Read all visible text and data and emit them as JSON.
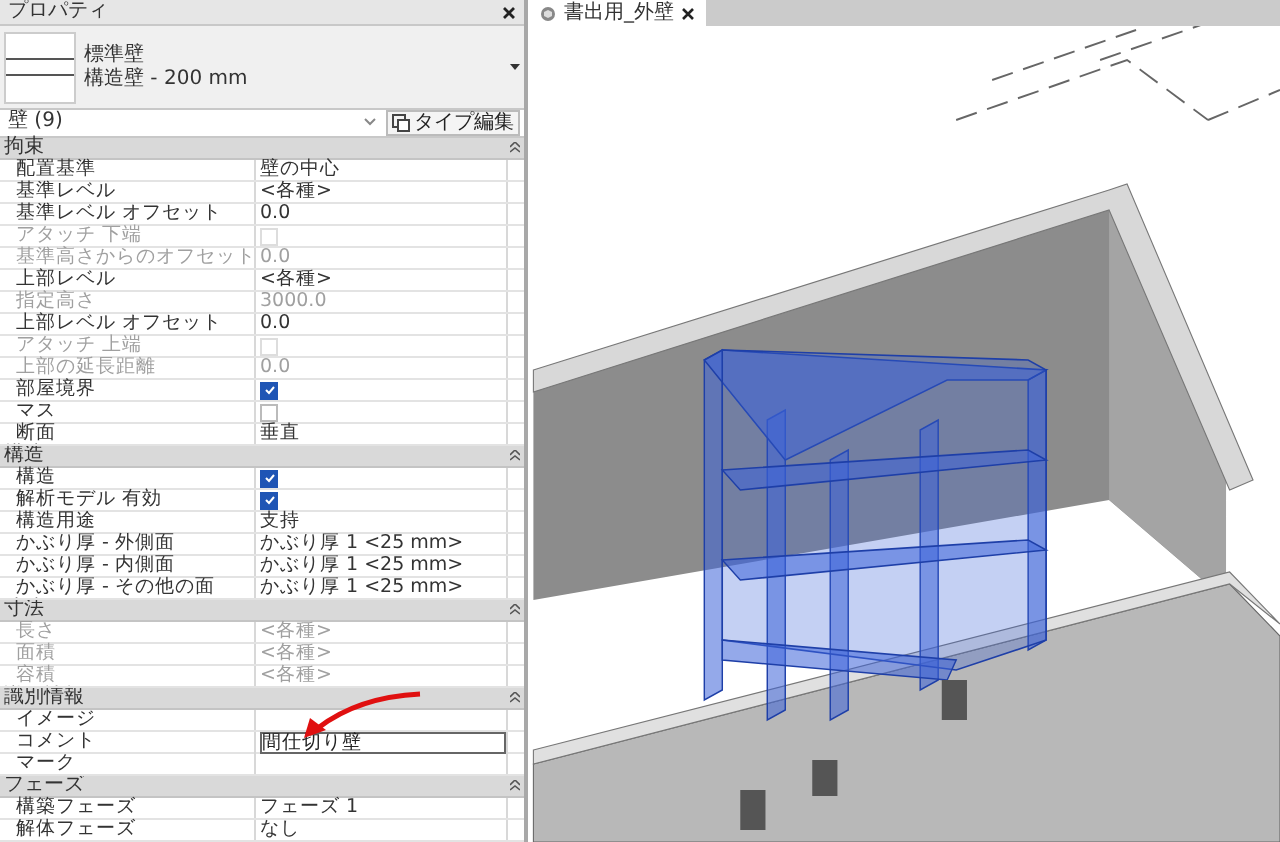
{
  "properties": {
    "title": "プロパティ",
    "type_name": "標準壁",
    "type_sub": "構造壁 - 200 mm",
    "filter": "壁 (9)",
    "edit_type": "タイプ編集",
    "groups": [
      {
        "title": "拘束",
        "rows": [
          {
            "label": "配置基準",
            "kind": "text",
            "value": "壁の中心",
            "disabled": false
          },
          {
            "label": "基準レベル",
            "kind": "text",
            "value": "<各種>",
            "disabled": false
          },
          {
            "label": "基準レベル オフセット",
            "kind": "text",
            "value": "0.0",
            "disabled": false
          },
          {
            "label": "アタッチ 下端",
            "kind": "check",
            "checked": false,
            "disabled": true
          },
          {
            "label": "基準高さからのオフセット",
            "kind": "text",
            "value": "0.0",
            "disabled": true
          },
          {
            "label": "上部レベル",
            "kind": "text",
            "value": "<各種>",
            "disabled": false
          },
          {
            "label": "指定高さ",
            "kind": "text",
            "value": "3000.0",
            "disabled": true
          },
          {
            "label": "上部レベル オフセット",
            "kind": "text",
            "value": "0.0",
            "disabled": false
          },
          {
            "label": "アタッチ 上端",
            "kind": "check",
            "checked": false,
            "disabled": true
          },
          {
            "label": "上部の延長距離",
            "kind": "text",
            "value": "0.0",
            "disabled": true
          },
          {
            "label": "部屋境界",
            "kind": "check",
            "checked": true,
            "disabled": false
          },
          {
            "label": "マス",
            "kind": "check",
            "checked": false,
            "disabled": false
          },
          {
            "label": "断面",
            "kind": "text",
            "value": "垂直",
            "disabled": false
          }
        ]
      },
      {
        "title": "構造",
        "rows": [
          {
            "label": "構造",
            "kind": "check",
            "checked": true,
            "disabled": false
          },
          {
            "label": "解析モデル 有効",
            "kind": "check",
            "checked": true,
            "disabled": false
          },
          {
            "label": "構造用途",
            "kind": "text",
            "value": "支持",
            "disabled": false
          },
          {
            "label": "かぶり厚 - 外側面",
            "kind": "text",
            "value": "かぶり厚 1 <25 mm>",
            "disabled": false
          },
          {
            "label": "かぶり厚 - 内側面",
            "kind": "text",
            "value": "かぶり厚 1 <25 mm>",
            "disabled": false
          },
          {
            "label": "かぶり厚 - その他の面",
            "kind": "text",
            "value": "かぶり厚 1 <25 mm>",
            "disabled": false
          }
        ]
      },
      {
        "title": "寸法",
        "rows": [
          {
            "label": "長さ",
            "kind": "text",
            "value": "<各種>",
            "disabled": true
          },
          {
            "label": "面積",
            "kind": "text",
            "value": "<各種>",
            "disabled": true
          },
          {
            "label": "容積",
            "kind": "text",
            "value": "<各種>",
            "disabled": true
          }
        ]
      },
      {
        "title": "識別情報",
        "rows": [
          {
            "label": "イメージ",
            "kind": "text",
            "value": "",
            "disabled": false
          },
          {
            "label": "コメント",
            "kind": "field",
            "value": "間仕切り壁",
            "disabled": false
          },
          {
            "label": "マーク",
            "kind": "text",
            "value": "",
            "disabled": false
          }
        ]
      },
      {
        "title": "フェーズ",
        "rows": [
          {
            "label": "構築フェーズ",
            "kind": "text",
            "value": "フェーズ 1",
            "disabled": false
          },
          {
            "label": "解体フェーズ",
            "kind": "text",
            "value": "なし",
            "disabled": false
          }
        ]
      }
    ]
  },
  "view_tab": {
    "label": "書出用_外壁"
  }
}
